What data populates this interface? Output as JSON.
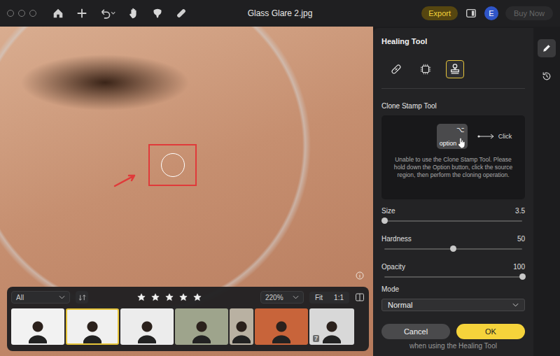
{
  "window": {
    "title": "Glass Glare 2.jpg"
  },
  "toolbar": {
    "export": "Export",
    "avatar": "E",
    "buy": "Buy Now"
  },
  "panel": {
    "title": "Healing Tool",
    "tools": [
      {
        "kind": "bandage",
        "selected": false
      },
      {
        "kind": "patch",
        "selected": false
      },
      {
        "kind": "stamp",
        "selected": true
      }
    ],
    "section": "Clone Stamp Tool",
    "hint": {
      "key_symbol": "⌥",
      "key_label": "option",
      "action": "Click",
      "message": "Unable to use the Clone Stamp Tool. Please hold down the Option button, click the source region, then perform the cloning operation."
    },
    "sliders": [
      {
        "label": "Size",
        "reading": "3.5",
        "level": 0.0
      },
      {
        "label": "Hardness",
        "reading": "50",
        "level": 0.5
      },
      {
        "label": "Opacity",
        "reading": "100",
        "level": 1.0
      }
    ],
    "mode": {
      "label": "Mode",
      "value": "Normal"
    },
    "buttons": {
      "cancel": "Cancel",
      "ok": "OK"
    },
    "footnote": "when using the Healing Tool"
  },
  "side_tabs": [
    {
      "kind": "edit",
      "selected": true
    },
    {
      "kind": "history",
      "selected": false
    }
  ],
  "filmstrip": {
    "filter": "All",
    "stars": 5,
    "max_stars": 5,
    "zoom": "220%",
    "fit": "Fit",
    "one_to_one": "1:1",
    "thumbs": [
      {
        "color": "#f2f2f2",
        "selected": false,
        "badge": ""
      },
      {
        "color": "#f0f0f0",
        "selected": true,
        "badge": ""
      },
      {
        "color": "#ececec",
        "selected": false,
        "badge": ""
      },
      {
        "color": "#9ea48c",
        "selected": false,
        "badge": ""
      },
      {
        "color": "#b9b1a2",
        "selected": false,
        "badge": ""
      },
      {
        "color": "#c8643a",
        "selected": false,
        "badge": ""
      },
      {
        "color": "#d8d8d8",
        "selected": false,
        "badge": "7"
      }
    ]
  }
}
